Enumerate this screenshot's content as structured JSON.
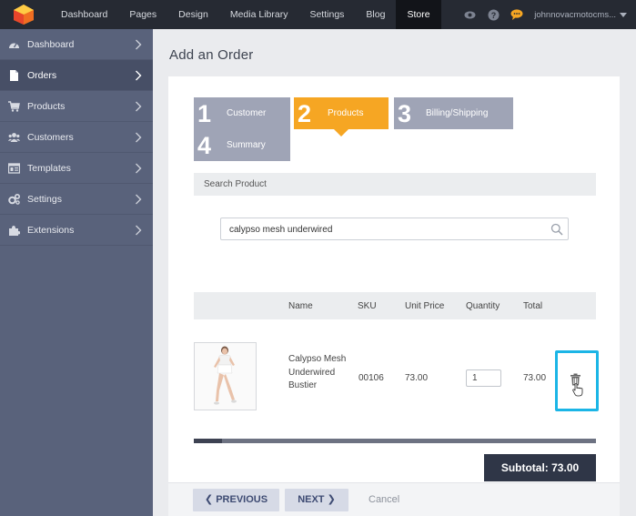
{
  "topnav": {
    "items": [
      "Dashboard",
      "Pages",
      "Design",
      "Media Library",
      "Settings",
      "Blog",
      "Store"
    ],
    "active": "Store",
    "username": "johnnovacmotocms..."
  },
  "sidebar": {
    "items": [
      {
        "label": "Dashboard",
        "icon": "dashboard-icon"
      },
      {
        "label": "Orders",
        "icon": "orders-icon"
      },
      {
        "label": "Products",
        "icon": "cart-icon"
      },
      {
        "label": "Customers",
        "icon": "users-icon"
      },
      {
        "label": "Templates",
        "icon": "templates-icon"
      },
      {
        "label": "Settings",
        "icon": "gears-icon"
      },
      {
        "label": "Extensions",
        "icon": "puzzle-icon"
      }
    ],
    "active": "Orders"
  },
  "page": {
    "title": "Add an Order"
  },
  "steps": [
    {
      "number": "1",
      "label": "Customer"
    },
    {
      "number": "2",
      "label": "Products"
    },
    {
      "number": "3",
      "label": "Billing/Shipping"
    },
    {
      "number": "4",
      "label": "Summary"
    }
  ],
  "search": {
    "label": "Search Product",
    "value": "calypso mesh underwired"
  },
  "table": {
    "headers": {
      "name": "Name",
      "sku": "SKU",
      "unit_price": "Unit Price",
      "quantity": "Quantity",
      "total": "Total"
    },
    "rows": [
      {
        "name": "Calypso Mesh Underwired Bustier",
        "sku": "00106",
        "unit_price": "73.00",
        "quantity": "1",
        "total": "73.00"
      }
    ]
  },
  "scroll_progress": 0.07,
  "subtotal": "Subtotal: 73.00",
  "footer": {
    "previous": "PREVIOUS",
    "next": "NEXT",
    "cancel": "Cancel"
  },
  "colors": {
    "step_active": "#f6a623",
    "step_inactive": "#9fa4b6",
    "highlight_border": "#1bb5e6",
    "sidebar_bg": "#59627b",
    "topbar_bg": "#262a33"
  }
}
